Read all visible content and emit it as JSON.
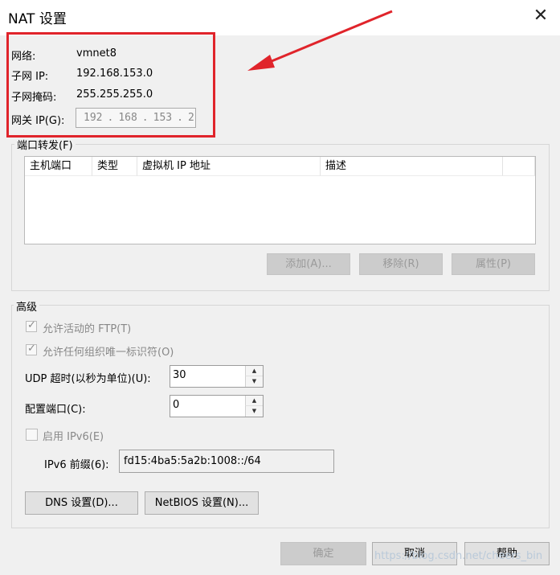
{
  "window": {
    "title": "NAT 设置",
    "close_icon": "close-icon"
  },
  "network": {
    "network_label": "网络:",
    "network_value": "vmnet8",
    "subnet_ip_label": "子网 IP:",
    "subnet_ip_value": "192.168.153.0",
    "subnet_mask_label": "子网掩码:",
    "subnet_mask_value": "255.255.255.0",
    "gateway_label": "网关 IP(G):",
    "gateway_octets": [
      "192",
      "168",
      "153",
      "2"
    ]
  },
  "port_forwarding": {
    "group_label": "端口转发(F)",
    "columns": [
      "主机端口",
      "类型",
      "虚拟机 IP 地址",
      "描述"
    ],
    "buttons": {
      "add": "添加(A)...",
      "remove": "移除(R)",
      "properties": "属性(P)"
    }
  },
  "advanced": {
    "group_label": "高级",
    "allow_ftp": "允许活动的 FTP(T)",
    "allow_oui": "允许任何组织唯一标识符(O)",
    "udp_timeout_label": "UDP 超时(以秒为单位)(U):",
    "udp_timeout_value": "30",
    "config_port_label": "配置端口(C):",
    "config_port_value": "0",
    "enable_ipv6": "启用 IPv6(E)",
    "ipv6_prefix_label": "IPv6 前缀(6):",
    "ipv6_prefix_value": "fd15:4ba5:5a2b:1008::/64",
    "dns_button": "DNS 设置(D)...",
    "netbios_button": "NetBIOS 设置(N)..."
  },
  "footer": {
    "ok": "确定",
    "cancel": "取消",
    "help": "帮助"
  },
  "watermark": "https://blog.csdn.net/cheers_bin",
  "annotation_color": "#e0242b"
}
